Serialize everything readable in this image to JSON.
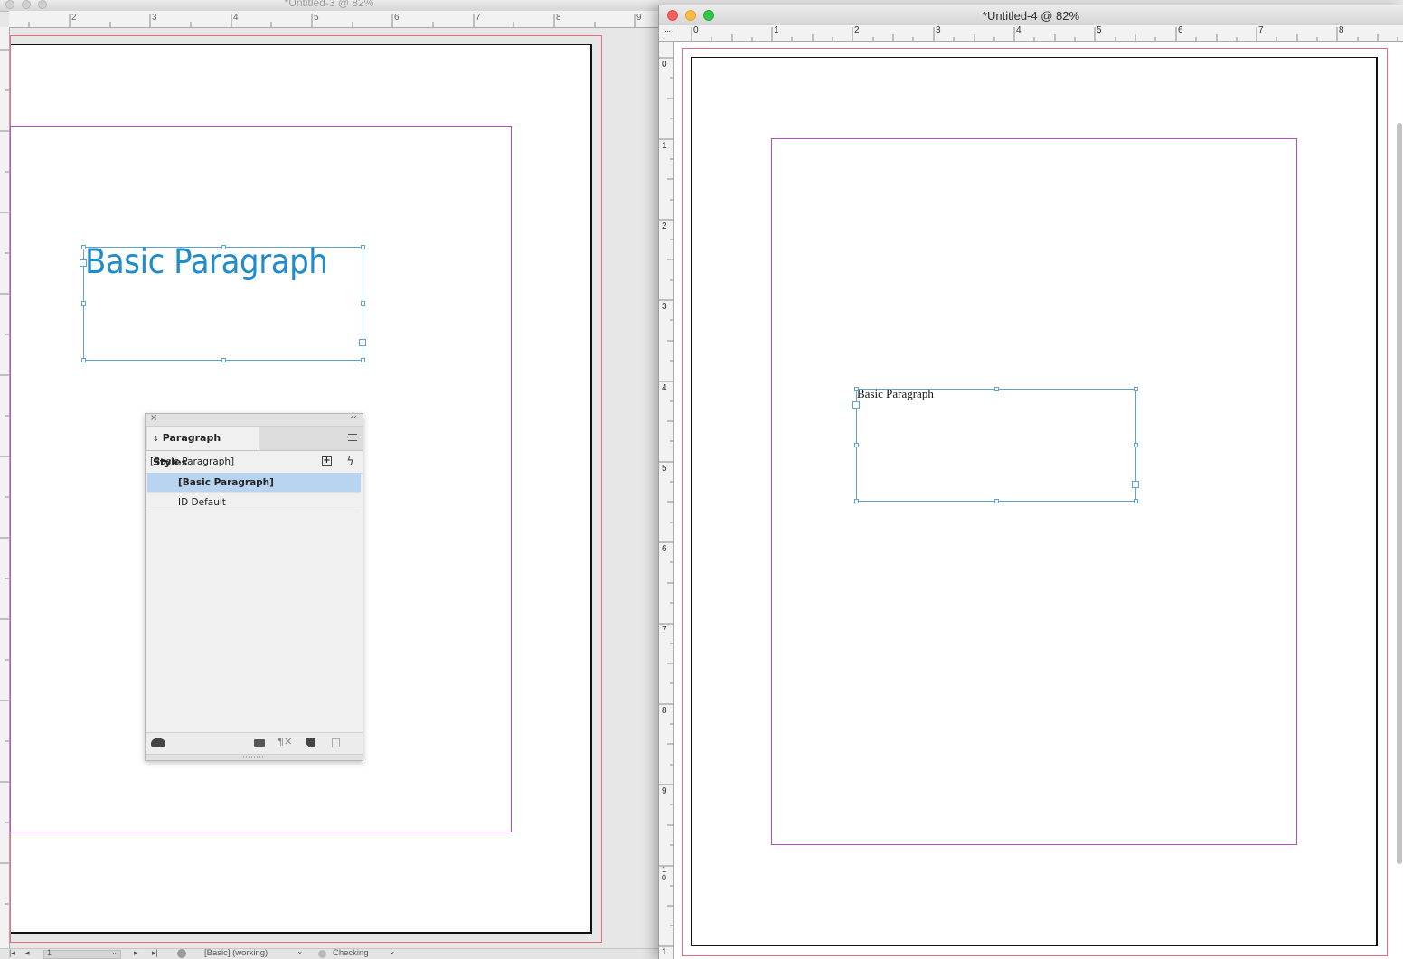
{
  "left_window": {
    "title": "*Untitled-3 @ 82%",
    "ruler_labels": [
      "2",
      "3",
      "4",
      "5",
      "6",
      "7",
      "8",
      "9"
    ],
    "text_frame_text": "Basic Paragraph",
    "text_color": "#1f8ccc",
    "status": {
      "page": "1",
      "preflight_profile": "[Basic] (working)",
      "preflight_state": "Checking"
    }
  },
  "right_window": {
    "title": "*Untitled-4 @ 82%",
    "ruler_h_labels": [
      "0",
      "1",
      "2",
      "3",
      "4",
      "5",
      "6",
      "7",
      "8"
    ],
    "ruler_v_labels": [
      "0",
      "1",
      "2",
      "3",
      "4",
      "5",
      "6",
      "7",
      "8",
      "9",
      "10",
      "1"
    ],
    "text_frame_text": "Basic Paragraph"
  },
  "paragraph_styles_panel": {
    "tab_label": "Paragraph Styles",
    "current_style": "[Basic Paragraph]",
    "styles": [
      {
        "label": "[Basic Paragraph]",
        "selected": true
      },
      {
        "label": "ID Default",
        "selected": false
      }
    ],
    "icons": [
      "close-icon",
      "collapse-icon",
      "panel-menu-icon",
      "new-style-from-selection-icon",
      "quick-apply-icon",
      "cloud-library-icon",
      "folder-icon",
      "clear-overrides-icon",
      "new-style-icon",
      "trash-icon"
    ]
  },
  "colors": {
    "bleed": "#ee6b7f",
    "margin": "#b94ccc",
    "frame": "#5fa3cf",
    "selection": "#b9d4f1"
  }
}
